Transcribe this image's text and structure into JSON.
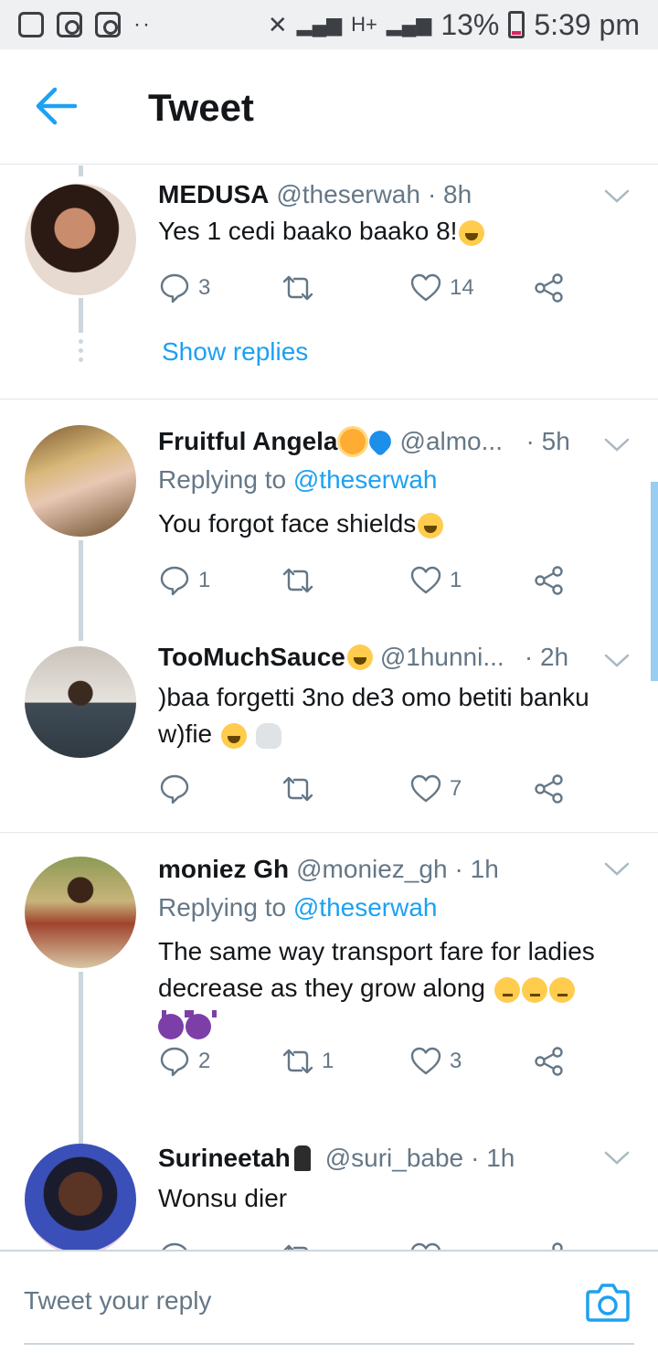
{
  "status_bar": {
    "signal_label": "H+",
    "battery": "13%",
    "time": "5:39 pm"
  },
  "header": {
    "title": "Tweet"
  },
  "tweets": [
    {
      "name": "MEDUSA",
      "handle": "@theserwah",
      "time": "· 8h",
      "text": "Yes 1 cedi baako baako 8!",
      "replies": "3",
      "retweets": "",
      "likes": "14",
      "show_replies": "Show replies"
    },
    {
      "name": "Fruitful Angela",
      "handle": "@almo...",
      "time": "· 5h",
      "replying_prefix": "Replying to",
      "replying_to": "@theserwah",
      "text": "You forgot face shields",
      "replies": "1",
      "retweets": "",
      "likes": "1"
    },
    {
      "name": "TooMuchSauce",
      "handle": "@1hunni...",
      "time": "· 2h",
      "text": ")baa forgetti 3no de3 omo betiti banku w)fie",
      "replies": "",
      "retweets": "",
      "likes": "7"
    },
    {
      "name": "moniez Gh",
      "handle": "@moniez_gh",
      "time": "· 1h",
      "replying_prefix": "Replying to",
      "replying_to": "@theserwah",
      "text": "The same way transport fare for ladies decrease as they grow along",
      "replies": "2",
      "retweets": "1",
      "likes": "3"
    },
    {
      "name": "Surineetah",
      "handle": "@suri_babe",
      "time": "· 1h",
      "text": "Wonsu dier"
    }
  ],
  "reply_bar": {
    "placeholder": "Tweet your reply"
  },
  "colors": {
    "accent": "#1da1f2",
    "muted": "#657786",
    "divider": "#e1e8ed"
  }
}
